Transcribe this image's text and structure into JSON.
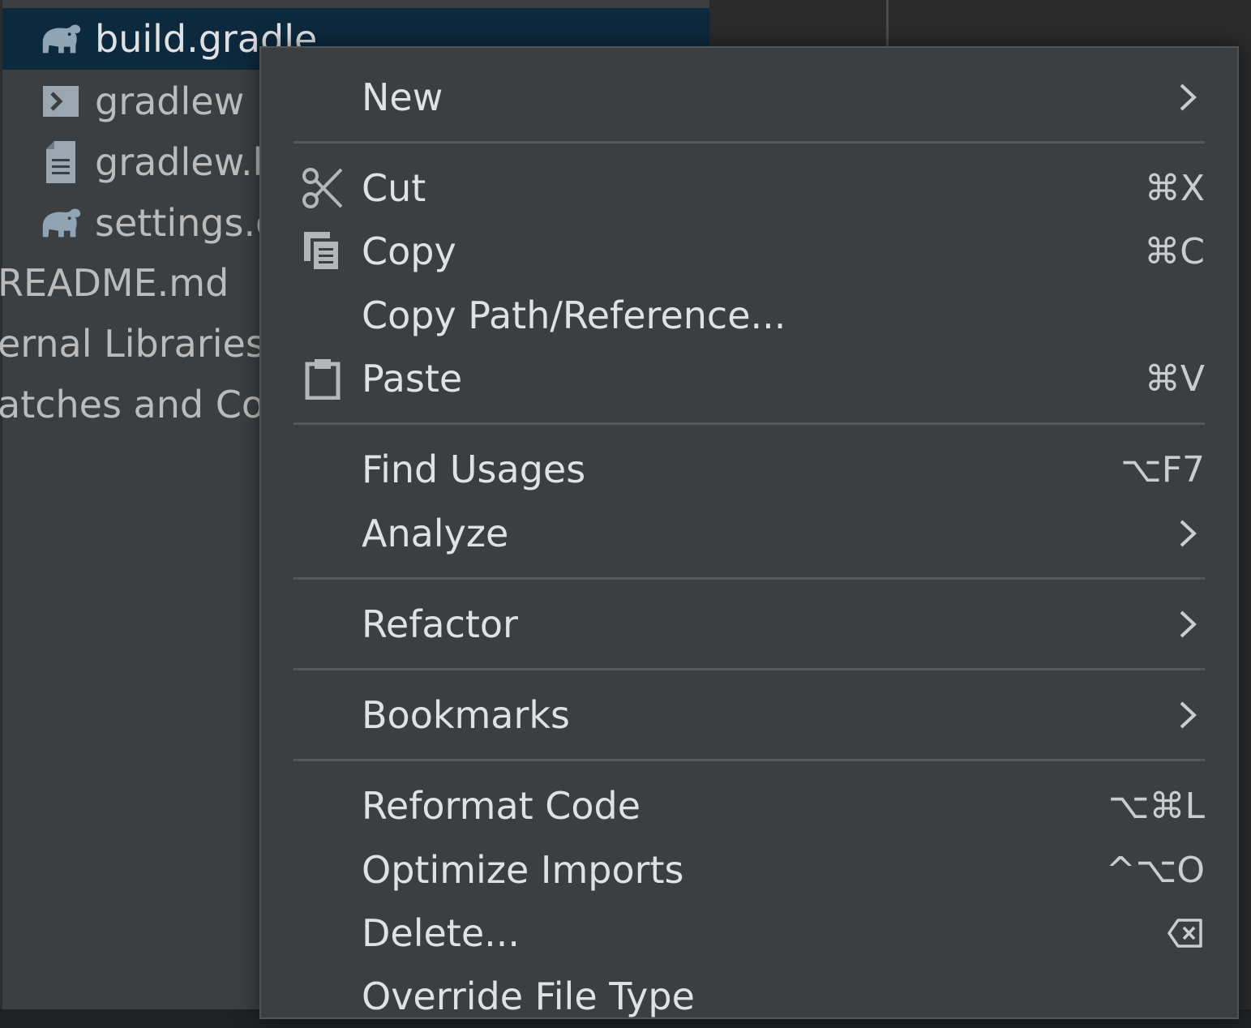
{
  "tree": {
    "items": [
      {
        "label": "build.gradle",
        "icon": "gradle-elephant-icon",
        "selected": true
      },
      {
        "label": "gradlew",
        "icon": "shell-script-icon"
      },
      {
        "label": "gradlew.b",
        "icon": "text-file-icon"
      },
      {
        "label": "settings.g",
        "icon": "gradle-elephant-icon"
      },
      {
        "label": "README.md"
      },
      {
        "label": "ernal Libraries"
      },
      {
        "label": "atches and Co"
      }
    ]
  },
  "menu": {
    "items": [
      {
        "label": "New",
        "submenu": true
      },
      {
        "label": "Cut",
        "shortcut": "⌘X",
        "icon": "scissors-icon"
      },
      {
        "label": "Copy",
        "shortcut": "⌘C",
        "icon": "copy-icon"
      },
      {
        "label": "Copy Path/Reference..."
      },
      {
        "label": "Paste",
        "shortcut": "⌘V",
        "icon": "clipboard-icon"
      },
      {
        "label": "Find Usages",
        "shortcut": "⌥F7"
      },
      {
        "label": "Analyze",
        "submenu": true
      },
      {
        "label": "Refactor",
        "submenu": true
      },
      {
        "label": "Bookmarks",
        "submenu": true
      },
      {
        "label": "Reformat Code",
        "shortcut": "⌥⌘L"
      },
      {
        "label": "Optimize Imports",
        "shortcut": "^⌥O"
      },
      {
        "label": "Delete...",
        "shortcut_icon": "delete-key-icon"
      },
      {
        "label": "Override File Type"
      }
    ]
  },
  "colors": {
    "menu_bg": "#3c3f41",
    "selection_bg": "#0d293e",
    "text": "#dfe1e5"
  }
}
